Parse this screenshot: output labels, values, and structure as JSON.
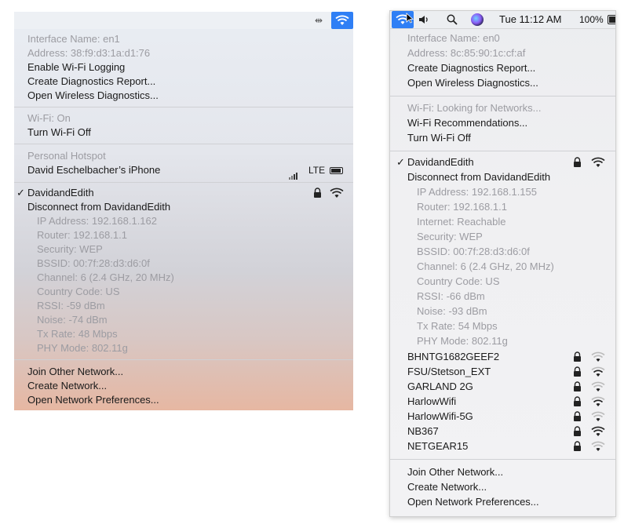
{
  "left_menu": {
    "interface_name": "Interface Name: en1",
    "address": "Address: 38:f9:d3:1a:d1:76",
    "enable_logging": "Enable Wi-Fi Logging",
    "create_report": "Create Diagnostics Report...",
    "open_diagnostics": "Open Wireless Diagnostics...",
    "wifi_status": "Wi-Fi: On",
    "turn_off": "Turn Wi-Fi Off",
    "hotspot_header": "Personal Hotspot",
    "hotspot_device": "David Eschelbacher’s iPhone",
    "hotspot_network_type": "LTE",
    "connected_network": "DavidandEdith",
    "disconnect": "Disconnect from DavidandEdith",
    "details": [
      "IP Address: 192.168.1.162",
      "Router: 192.168.1.1",
      "Security: WEP",
      "BSSID: 00:7f:28:d3:d6:0f",
      "Channel: 6 (2.4 GHz, 20 MHz)",
      "Country Code: US",
      "RSSI: -59 dBm",
      "Noise: -74 dBm",
      "Tx Rate: 48 Mbps",
      "PHY Mode: 802.11g"
    ],
    "join_other": "Join Other Network...",
    "create_network": "Create Network...",
    "open_prefs": "Open Network Preferences..."
  },
  "right_menubar": {
    "clock": "Tue 11:12 AM",
    "battery": "100%"
  },
  "right_menu": {
    "interface_name": "Interface Name: en0",
    "address": "Address: 8c:85:90:1c:cf:af",
    "create_report": "Create Diagnostics Report...",
    "open_diagnostics": "Open Wireless Diagnostics...",
    "wifi_status": "Wi-Fi: Looking for Networks...",
    "recommendations": "Wi-Fi Recommendations...",
    "turn_off": "Turn Wi-Fi Off",
    "connected_network": "DavidandEdith",
    "disconnect": "Disconnect from DavidandEdith",
    "details": [
      "IP Address: 192.168.1.155",
      "Router: 192.168.1.1",
      "Internet: Reachable",
      "Security: WEP",
      "BSSID: 00:7f:28:d3:d6:0f",
      "Channel: 6 (2.4 GHz, 20 MHz)",
      "Country Code: US",
      "RSSI: -66 dBm",
      "Noise: -93 dBm",
      "Tx Rate: 54 Mbps",
      "PHY Mode: 802.11g"
    ],
    "networks": [
      "BHNTG1682GEEF2",
      "FSU/Stetson_EXT",
      "GARLAND 2G",
      "HarlowWifi",
      "HarlowWifi-5G",
      "NB367",
      "NETGEAR15"
    ],
    "join_other": "Join Other Network...",
    "create_network": "Create Network...",
    "open_prefs": "Open Network Preferences..."
  },
  "colors": {
    "accent": "#2f7ff5",
    "dim_text": "#9c9ca2"
  },
  "icons": [
    "wifi-icon",
    "lock-icon",
    "volume-icon",
    "search-icon",
    "siri-icon",
    "battery-icon",
    "cellular-bars-icon",
    "checkmark-icon"
  ]
}
